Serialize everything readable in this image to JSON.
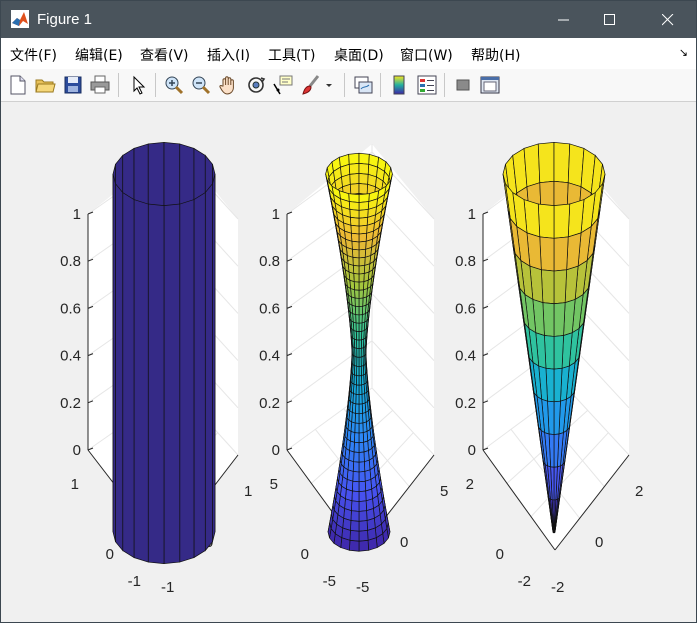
{
  "window": {
    "title": "Figure 1",
    "controls": {
      "minimize": "—",
      "maximize": "☐",
      "close": "✕"
    }
  },
  "menubar": {
    "items": [
      {
        "label": "文件(F)"
      },
      {
        "label": "编辑(E)"
      },
      {
        "label": "查看(V)"
      },
      {
        "label": "插入(I)"
      },
      {
        "label": "工具(T)"
      },
      {
        "label": "桌面(D)"
      },
      {
        "label": "窗口(W)"
      },
      {
        "label": "帮助(H)"
      }
    ]
  },
  "toolbar": {
    "buttons": [
      "new-figure",
      "open-file",
      "save",
      "print",
      "edit-plot",
      "zoom-in",
      "zoom-out",
      "pan",
      "rotate-3d",
      "data-cursor",
      "brush",
      "link-plot",
      "colorbar",
      "legend",
      "hide-tools",
      "show-tools"
    ]
  },
  "chart_data": [
    {
      "type": "surface",
      "surface": "cylinder",
      "colormap": "constant (dark blue)",
      "z_ticks": [
        "0",
        "0.2",
        "0.4",
        "0.6",
        "0.8",
        "1"
      ],
      "x_ticks": [
        "-1",
        "0",
        "1"
      ],
      "y_ticks": [
        "-1",
        "0",
        "1"
      ],
      "zlim": [
        0,
        1
      ],
      "xlim": [
        -1,
        1
      ],
      "ylim": [
        -1,
        1
      ]
    },
    {
      "type": "surface",
      "surface": "hourglass",
      "colormap": "parula",
      "z_ticks": [
        "0",
        "0.2",
        "0.4",
        "0.6",
        "0.8",
        "1"
      ],
      "x_ticks": [
        "-5",
        "0",
        "5"
      ],
      "y_ticks": [
        "-5",
        "0",
        "5"
      ],
      "zlim": [
        0,
        1
      ],
      "xlim": [
        -5,
        5
      ],
      "ylim": [
        -5,
        5
      ]
    },
    {
      "type": "surface",
      "surface": "cone",
      "colormap": "parula",
      "z_ticks": [
        "0",
        "0.2",
        "0.4",
        "0.6",
        "0.8",
        "1"
      ],
      "x_ticks": [
        "-2",
        "0",
        "2"
      ],
      "y_ticks": [
        "-2",
        "0",
        "2"
      ],
      "zlim": [
        0,
        1
      ],
      "xlim": [
        -2,
        2
      ],
      "ylim": [
        -2,
        2
      ]
    }
  ]
}
